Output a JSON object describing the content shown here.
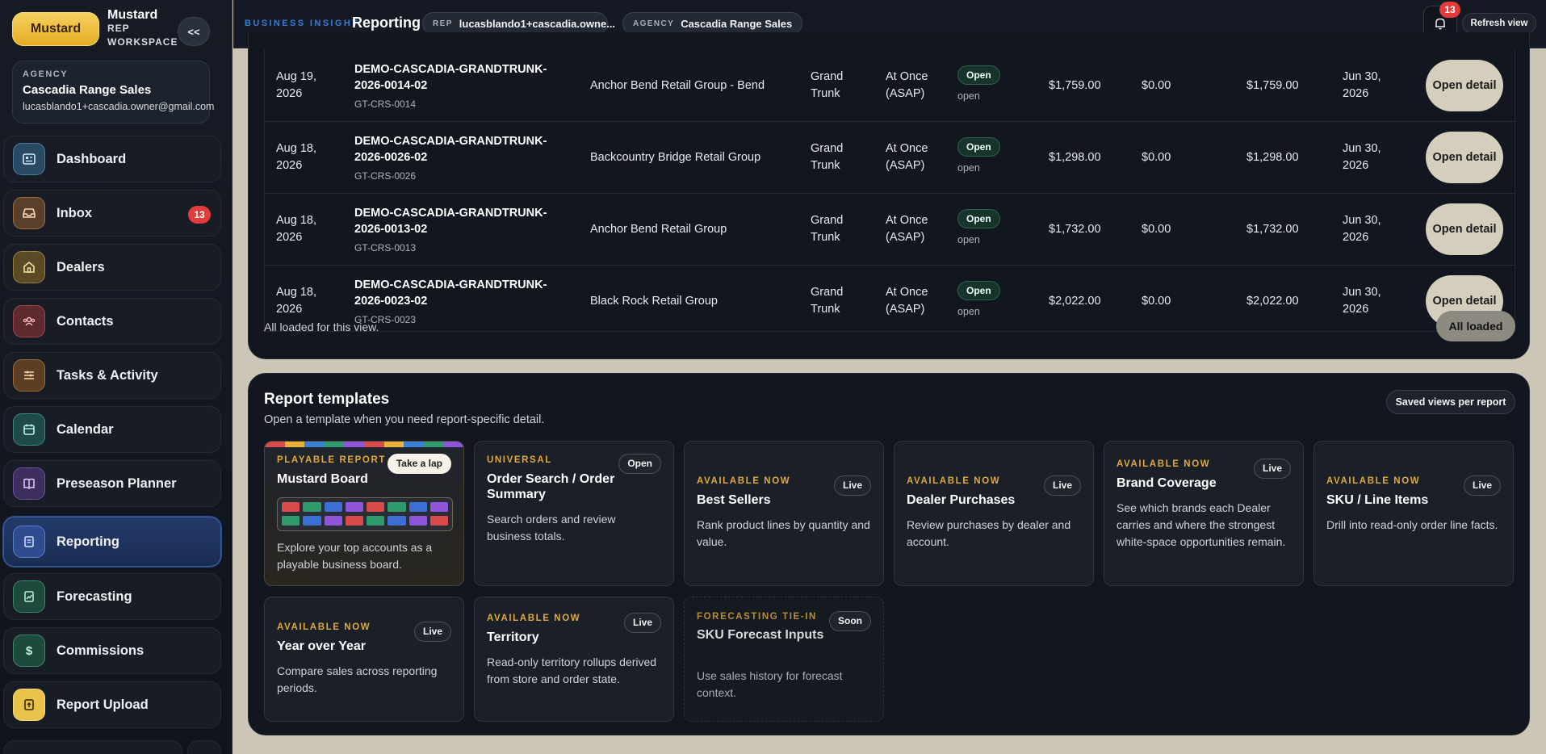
{
  "sidebar": {
    "brand_button": "Mustard",
    "brand_title": "Mustard",
    "brand_subtitle_1": "REP",
    "brand_subtitle_2": "WORKSPACE",
    "collapse_label": "<<",
    "agency": {
      "label": "AGENCY",
      "name": "Cascadia Range Sales",
      "email": "lucasblando1+cascadia.owner@gmail.com"
    },
    "items": [
      {
        "label": "Dashboard",
        "icon": "dashboard-icon"
      },
      {
        "label": "Inbox",
        "icon": "inbox-icon",
        "badge": "13"
      },
      {
        "label": "Dealers",
        "icon": "store-icon"
      },
      {
        "label": "Contacts",
        "icon": "contacts-icon"
      },
      {
        "label": "Tasks & Activity",
        "icon": "tasks-icon"
      },
      {
        "label": "Calendar",
        "icon": "calendar-icon"
      },
      {
        "label": "Preseason Planner",
        "icon": "book-icon"
      },
      {
        "label": "Reporting",
        "icon": "report-icon",
        "active": true
      },
      {
        "label": "Forecasting",
        "icon": "forecast-icon"
      },
      {
        "label": "Commissions",
        "icon": "dollar-icon"
      },
      {
        "label": "Report Upload",
        "icon": "upload-icon"
      }
    ]
  },
  "topbar": {
    "eyebrow": "BUSINESS INSIGHT",
    "title": "Reporting",
    "rep_key": "REP",
    "rep_value": "lucasblando1+cascadia.owne...",
    "agency_key": "AGENCY",
    "agency_value": "Cascadia Range Sales",
    "notification_count": "13",
    "refresh_label": "Refresh view"
  },
  "orders": {
    "rows": [
      {
        "date": "Aug 19, 2026",
        "order_id": "DEMO-CASCADIA-GRANDTRUNK-2026-0014-02",
        "ref": "GT-CRS-0014",
        "dealer": "Anchor Bend Retail Group - Bend",
        "brand": "Grand Trunk",
        "ship": "At Once (ASAP)",
        "status": "Open",
        "status_sub": "open",
        "total": "$1,759.00",
        "paid": "$0.00",
        "balance": "$1,759.00",
        "due": "Jun 30, 2026",
        "action": "Open detail"
      },
      {
        "date": "Aug 18, 2026",
        "order_id": "DEMO-CASCADIA-GRANDTRUNK-2026-0026-02",
        "ref": "GT-CRS-0026",
        "dealer": "Backcountry Bridge Retail Group",
        "brand": "Grand Trunk",
        "ship": "At Once (ASAP)",
        "status": "Open",
        "status_sub": "open",
        "total": "$1,298.00",
        "paid": "$0.00",
        "balance": "$1,298.00",
        "due": "Jun 30, 2026",
        "action": "Open detail"
      },
      {
        "date": "Aug 18, 2026",
        "order_id": "DEMO-CASCADIA-GRANDTRUNK-2026-0013-02",
        "ref": "GT-CRS-0013",
        "dealer": "Anchor Bend Retail Group",
        "brand": "Grand Trunk",
        "ship": "At Once (ASAP)",
        "status": "Open",
        "status_sub": "open",
        "total": "$1,732.00",
        "paid": "$0.00",
        "balance": "$1,732.00",
        "due": "Jun 30, 2026",
        "action": "Open detail"
      },
      {
        "date": "Aug 18, 2026",
        "order_id": "DEMO-CASCADIA-GRANDTRUNK-2026-0023-02",
        "ref": "GT-CRS-0023",
        "dealer": "Black Rock Retail Group",
        "brand": "Grand Trunk",
        "ship": "At Once (ASAP)",
        "status": "Open",
        "status_sub": "open",
        "total": "$2,022.00",
        "paid": "$0.00",
        "balance": "$2,022.00",
        "due": "Jun 30, 2026",
        "action": "Open detail"
      }
    ],
    "footer_text": "All loaded for this view.",
    "footer_button": "All loaded"
  },
  "templates": {
    "title": "Report templates",
    "subtitle": "Open a template when you need report-specific detail.",
    "saved_views_label": "Saved views per report",
    "stripe_colors": [
      "#d94a4a",
      "#e8b23a",
      "#3b82d6",
      "#2f9a6b",
      "#8e55d8",
      "#d94a4a",
      "#e8b23a",
      "#3b82d6",
      "#2f9a6b",
      "#8e55d8"
    ],
    "board_colors": [
      "#d94a4a",
      "#2f9a6b",
      "#3b6fd6",
      "#8e55d8",
      "#d94a4a",
      "#2f9a6b",
      "#3b6fd6",
      "#8e55d8"
    ],
    "cards": [
      {
        "eyebrow": "PLAYABLE REPORT",
        "name": "Mustard Board",
        "chip": "Take a lap",
        "desc": "Explore your top accounts as a playable business board."
      },
      {
        "eyebrow": "UNIVERSAL",
        "name": "Order Search / Order Summary",
        "chip": "Open",
        "desc": "Search orders and review business totals."
      },
      {
        "eyebrow": "AVAILABLE NOW",
        "name": "Best Sellers",
        "chip": "Live",
        "desc": "Rank product lines by quantity and value."
      },
      {
        "eyebrow": "AVAILABLE NOW",
        "name": "Dealer Purchases",
        "chip": "Live",
        "desc": "Review purchases by dealer and account."
      },
      {
        "eyebrow": "AVAILABLE NOW",
        "name": "Brand Coverage",
        "chip": "Live",
        "desc": "See which brands each Dealer carries and where the strongest white-space opportunities remain."
      },
      {
        "eyebrow": "AVAILABLE NOW",
        "name": "SKU / Line Items",
        "chip": "Live",
        "desc": "Drill into read-only order line facts."
      },
      {
        "eyebrow": "AVAILABLE NOW",
        "name": "Year over Year",
        "chip": "Live",
        "desc": "Compare sales across reporting periods."
      },
      {
        "eyebrow": "AVAILABLE NOW",
        "name": "Territory",
        "chip": "Live",
        "desc": "Read-only territory rollups derived from store and order state."
      },
      {
        "eyebrow": "FORECASTING TIE-IN",
        "name": "SKU Forecast Inputs",
        "chip": "Soon",
        "desc": "Use sales history for forecast context."
      }
    ]
  }
}
